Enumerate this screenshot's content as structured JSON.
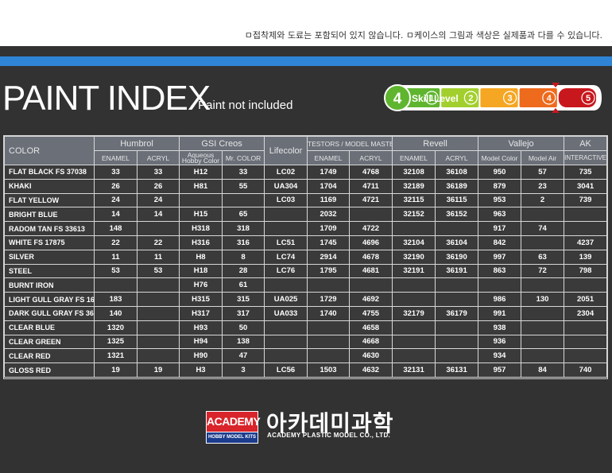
{
  "notice": "ㅁ접착제와 도료는 포함되어 있지 않습니다. ㅁ케이스의 그림과 색상은 실제품과 다를 수 있습니다.",
  "title": "PAINT INDEX",
  "subtitle": "- Paint not included",
  "skill": {
    "label": "Skill Level",
    "current": "4",
    "levels": [
      "1",
      "2",
      "3",
      "4",
      "5"
    ],
    "colors": [
      "#5fb52e",
      "#a3cf2e",
      "#f5a623",
      "#ee6a1c",
      "#c8171d"
    ]
  },
  "table": {
    "color_header": "COLOR",
    "brands": {
      "humbrol": "Humbrol",
      "gsi": "GSI Creos",
      "lifecolor": "Lifecolor",
      "testors": "TESTORS / MODEL MASTER",
      "revell": "Revell",
      "vallejo": "Vallejo",
      "ak": "AK",
      "ak2": "INTERACTIVE"
    },
    "sub": {
      "hum_enamel": "ENAMEL",
      "hum_acryl": "ACRYL",
      "gsi_aq1": "Aqueous",
      "gsi_aq2": "Hobby Color",
      "gsi_mr": "Mr. COLOR",
      "tes_enamel": "ENAMEL",
      "tes_acryl": "ACRYL",
      "rev_enamel": "ENAMEL",
      "rev_acryl": "ACRYL",
      "val_mc": "Model Color",
      "val_ma": "Model Air"
    },
    "rows": [
      [
        "FLAT BLACK FS 37038",
        "33",
        "33",
        "H12",
        "33",
        "LC02",
        "1749",
        "4768",
        "32108",
        "36108",
        "950",
        "57",
        "735"
      ],
      [
        "KHAKI",
        "26",
        "26",
        "H81",
        "55",
        "UA304",
        "1704",
        "4711",
        "32189",
        "36189",
        "879",
        "23",
        "3041"
      ],
      [
        "FLAT YELLOW",
        "24",
        "24",
        "",
        "",
        "LC03",
        "1169",
        "4721",
        "32115",
        "36115",
        "953",
        "2",
        "739"
      ],
      [
        "BRIGHT BLUE",
        "14",
        "14",
        "H15",
        "65",
        "",
        "2032",
        "",
        "32152",
        "36152",
        "963",
        "",
        ""
      ],
      [
        "RADOM TAN FS 33613",
        "148",
        "",
        "H318",
        "318",
        "",
        "1709",
        "4722",
        "",
        "",
        "917",
        "74",
        ""
      ],
      [
        "WHITE FS 17875",
        "22",
        "22",
        "H316",
        "316",
        "LC51",
        "1745",
        "4696",
        "32104",
        "36104",
        "842",
        "",
        "4237"
      ],
      [
        "SILVER",
        "11",
        "11",
        "H8",
        "8",
        "LC74",
        "2914",
        "4678",
        "32190",
        "36190",
        "997",
        "63",
        "139"
      ],
      [
        "STEEL",
        "53",
        "53",
        "H18",
        "28",
        "LC76",
        "1795",
        "4681",
        "32191",
        "36191",
        "863",
        "72",
        "798"
      ],
      [
        "BURNT IRON",
        "",
        "",
        "H76",
        "61",
        "",
        "",
        "",
        "",
        "",
        "",
        "",
        ""
      ],
      [
        "LIGHT GULL GRAY FS 16440",
        "183",
        "",
        "H315",
        "315",
        "UA025",
        "1729",
        "4692",
        "",
        "",
        "986",
        "130",
        "2051"
      ],
      [
        "DARK GULL GRAY FS 36231",
        "140",
        "",
        "H317",
        "317",
        "UA033",
        "1740",
        "4755",
        "32179",
        "36179",
        "991",
        "",
        "2304"
      ],
      [
        "CLEAR BLUE",
        "1320",
        "",
        "H93",
        "50",
        "",
        "",
        "4658",
        "",
        "",
        "938",
        "",
        ""
      ],
      [
        "CLEAR GREEN",
        "1325",
        "",
        "H94",
        "138",
        "",
        "",
        "4668",
        "",
        "",
        "936",
        "",
        ""
      ],
      [
        "CLEAR RED",
        "1321",
        "",
        "H90",
        "47",
        "",
        "",
        "4630",
        "",
        "",
        "934",
        "",
        ""
      ],
      [
        "GLOSS RED",
        "19",
        "19",
        "H3",
        "3",
        "LC56",
        "1503",
        "4632",
        "32131",
        "36131",
        "957",
        "84",
        "740"
      ]
    ]
  },
  "brand": {
    "logo_top": "ACADEMY",
    "logo_bottom": "HOBBY MODEL KITS",
    "korean": "아카데미과학",
    "english": "ACADEMY PLASTIC MODEL CO., LTD."
  }
}
